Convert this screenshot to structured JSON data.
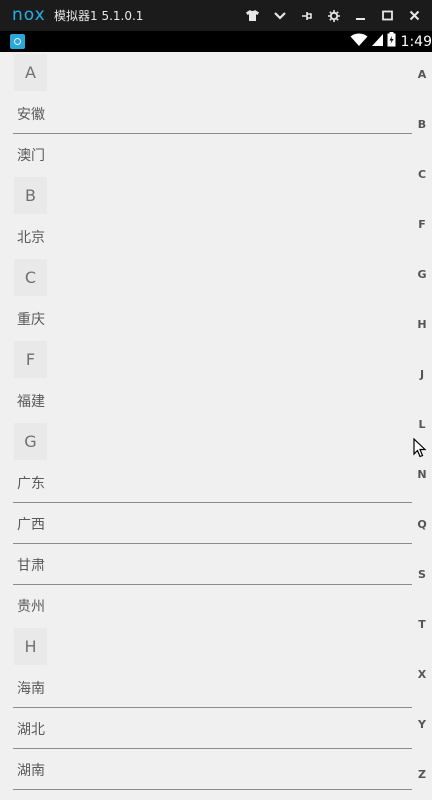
{
  "window": {
    "logo": "nox",
    "title": "模拟器1  5.1.0.1",
    "controls": [
      "tshirt-icon",
      "chevron-down-icon",
      "pin-icon",
      "gear-icon",
      "minimize-icon",
      "maximize-icon",
      "close-icon"
    ]
  },
  "status_bar": {
    "time": "1:49",
    "icons": [
      "app-notification-icon",
      "wifi-icon",
      "signal-icon",
      "battery-icon"
    ]
  },
  "sections": [
    {
      "letter": "A",
      "items": [
        "安徽",
        "澳门"
      ]
    },
    {
      "letter": "B",
      "items": [
        "北京"
      ]
    },
    {
      "letter": "C",
      "items": [
        "重庆"
      ]
    },
    {
      "letter": "F",
      "items": [
        "福建"
      ]
    },
    {
      "letter": "G",
      "items": [
        "广东",
        "广西",
        "甘肃",
        "贵州"
      ]
    },
    {
      "letter": "H",
      "items": [
        "海南",
        "湖北",
        "湖南"
      ]
    }
  ],
  "index_bar": [
    "A",
    "B",
    "C",
    "F",
    "G",
    "H",
    "J",
    "L",
    "N",
    "Q",
    "S",
    "T",
    "X",
    "Y",
    "Z"
  ]
}
